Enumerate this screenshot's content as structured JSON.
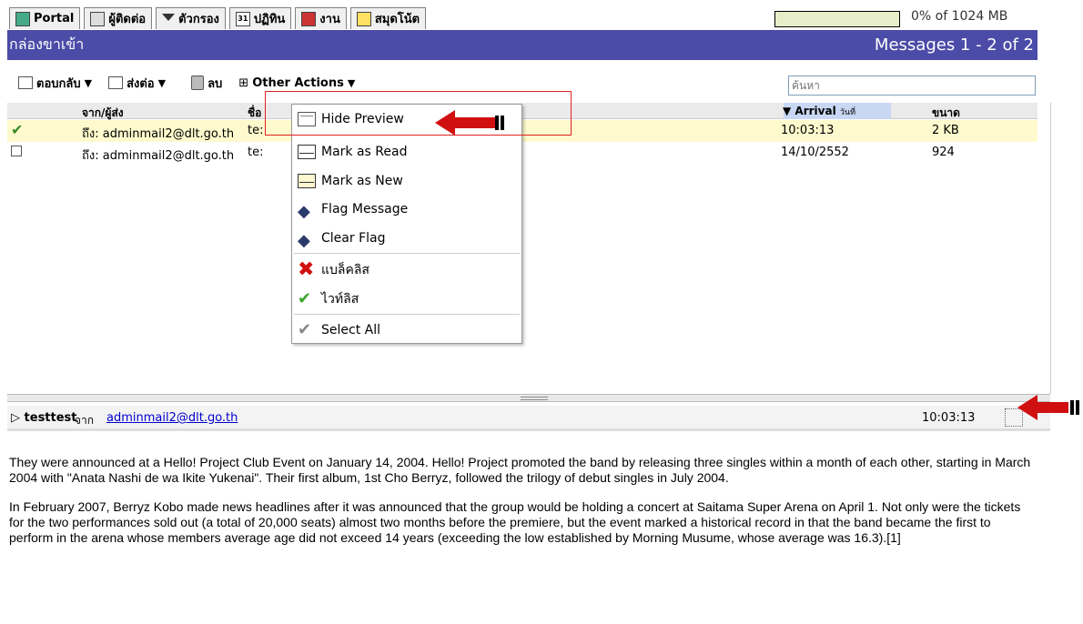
{
  "apptabs": [
    {
      "label": "Portal",
      "icon": "portal-icon"
    },
    {
      "label": "ผู้ติดต่อ",
      "icon": "contacts-icon"
    },
    {
      "label": "ตัวกรอง",
      "icon": "filter-icon"
    },
    {
      "label": "ปฏิทิน",
      "icon": "calendar-icon",
      "badge": "31"
    },
    {
      "label": "งาน",
      "icon": "task-icon"
    },
    {
      "label": "สมุดโน้ต",
      "icon": "notes-icon"
    }
  ],
  "quota": {
    "used_percent": 0,
    "text": "0% of 1024 MB"
  },
  "titlebar": {
    "folder": "กล่องขาเข้า",
    "range": "Messages 1 - 2 of 2",
    "color": "#4b4ba8"
  },
  "toolbar": {
    "reply": "ตอบกลับ",
    "forward": "ส่งต่อ",
    "delete": "ลบ",
    "other": "Other Actions",
    "other_prefix": "⊞",
    "search_placeholder": "ค้นหา"
  },
  "columns": {
    "from": "จาก/ผู้ส่ง",
    "subject": "ชื่อ",
    "arrival": "▼ Arrival",
    "arrival_sub": "วันที่",
    "size": "ขนาด"
  },
  "messages": [
    {
      "checked": true,
      "from": "ถึง: adminmail2@dlt.go.th",
      "subject": "te:",
      "arrival": "10:03:13",
      "size": "2 KB"
    },
    {
      "checked": false,
      "from": "ถึง: adminmail2@dlt.go.th",
      "subject": "te:",
      "arrival": "14/10/2552",
      "size": "924"
    }
  ],
  "menu": {
    "items": [
      {
        "label": "Hide Preview",
        "icon": "preview-icon"
      },
      {
        "label": "Mark as Read",
        "icon": "read-mail-icon"
      },
      {
        "label": "Mark as New",
        "icon": "new-mail-icon"
      },
      {
        "label": "Flag Message",
        "icon": "flag-icon"
      },
      {
        "label": "Clear Flag",
        "icon": "clear-flag-icon"
      },
      {
        "label": "แบล็คลิส",
        "icon": "blacklist-icon"
      },
      {
        "label": "ไวท์ลิส",
        "icon": "whitelist-icon"
      },
      {
        "label": "Select All",
        "icon": "select-all-icon"
      }
    ]
  },
  "preview": {
    "subject": "testtest",
    "from_label": "จาก",
    "from_addr": "adminmail2@dlt.go.th",
    "time": "10:03:13",
    "paragraphs": [
      "They were announced at a Hello! Project Club Event on January 14, 2004. Hello! Project promoted the band by releasing three singles within a month of each other, starting in March 2004 with \"Anata Nashi de wa Ikite Yukenai\". Their first album, 1st Cho Berryz, followed the trilogy of debut singles in July 2004.",
      "In February 2007, Berryz Kobo made news headlines after it was announced that the group would be holding a concert at Saitama Super Arena on April 1. Not only were the tickets for the two performances sold out (a total of 20,000 seats) almost two months before the premiere, but the event marked a historical record in that the band became the first to perform in the arena whose members average age did not exceed 14 years (exceeding the low established by Morning Musume, whose average was 16.3).[1]"
    ]
  }
}
